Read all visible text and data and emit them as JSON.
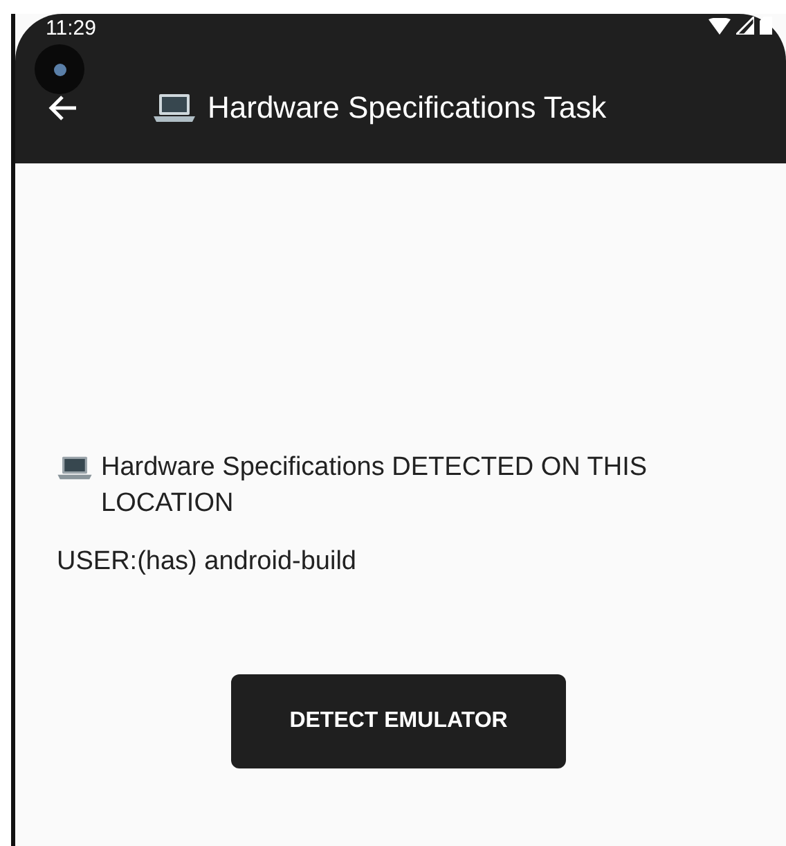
{
  "status_bar": {
    "time": "11:29"
  },
  "app_bar": {
    "title": "Hardware Specifications Task"
  },
  "content": {
    "heading": "Hardware Specifications DETECTED ON THIS LOCATION",
    "user_line": "USER:(has) android-build"
  },
  "buttons": [
    {
      "label": "DETECT EMULATOR"
    }
  ]
}
